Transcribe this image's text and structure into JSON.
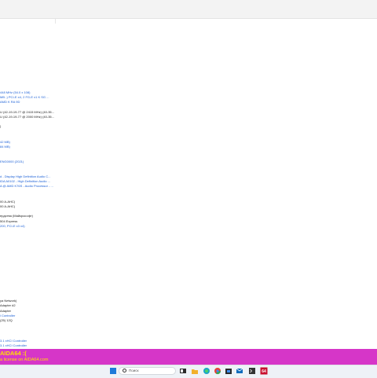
{
  "values": [
    {
      "text": "448 MHz (54.0 x 108)",
      "link": true
    },
    {
      "text": "MB -) PCI-E x4, 2 FG-E x1 K SG ...",
      "link": true
    },
    {
      "text": "AMD K RA 9D",
      "link": true
    },
    {
      "text": "U (42-19-19-77 @ 2415 MHz) (40-35...",
      "link": false
    },
    {
      "text": "U (42-19-19-77 @ 2000 MHz) (40-35...",
      "link": false
    },
    {
      "text": ")",
      "link": false
    },
    {
      "text": "42 MB)",
      "link": true
    },
    {
      "text": "84 MB)",
      "link": true
    },
    {
      "text": "ENG0000 (2021)",
      "link": true
    },
    {
      "text": "d - Display High Definition Audio C...",
      "link": true
    },
    {
      "text": "IDA A0102 - High Definition Audio ...",
      "link": true
    },
    {
      "text": "A @ AMD K76S - Audio Processor - ...",
      "link": true
    },
    {
      "text": "00 A-AHC)",
      "link": false
    },
    {
      "text": "00 A-AHC)",
      "link": false
    },
    {
      "text": "ердства (Майкрософт)",
      "link": false
    },
    {
      "text": "504 Express",
      "link": false
    },
    {
      "text": "200, PCI-E x3 x4)",
      "link": true
    },
    {
      "text": "ya Network)",
      "link": false
    },
    {
      "text": "Adapter #2",
      "link": false
    },
    {
      "text": "Adapter",
      "link": false
    },
    {
      "text": "i Controller",
      "link": true
    },
    {
      "text": "(25) 12Q",
      "link": false
    },
    {
      "text": "3.1 xHCI Controller",
      "link": true
    },
    {
      "text": "3.1 xHCI Controller",
      "link": true
    }
  ],
  "banner": {
    "title": "AIDA64 :(",
    "subtitle": "a license on AIDA64.com"
  },
  "taskbar": {
    "search_placeholder": "Поиск",
    "apps": [
      "files-icon",
      "folder-icon",
      "edge-icon",
      "chrome-icon",
      "store-icon",
      "mail-icon",
      "terminal-icon",
      "aida64-icon"
    ]
  },
  "colors": {
    "banner_bg": "#d636c8",
    "banner_text": "#ffe100",
    "link_text": "#1a5fd6"
  }
}
